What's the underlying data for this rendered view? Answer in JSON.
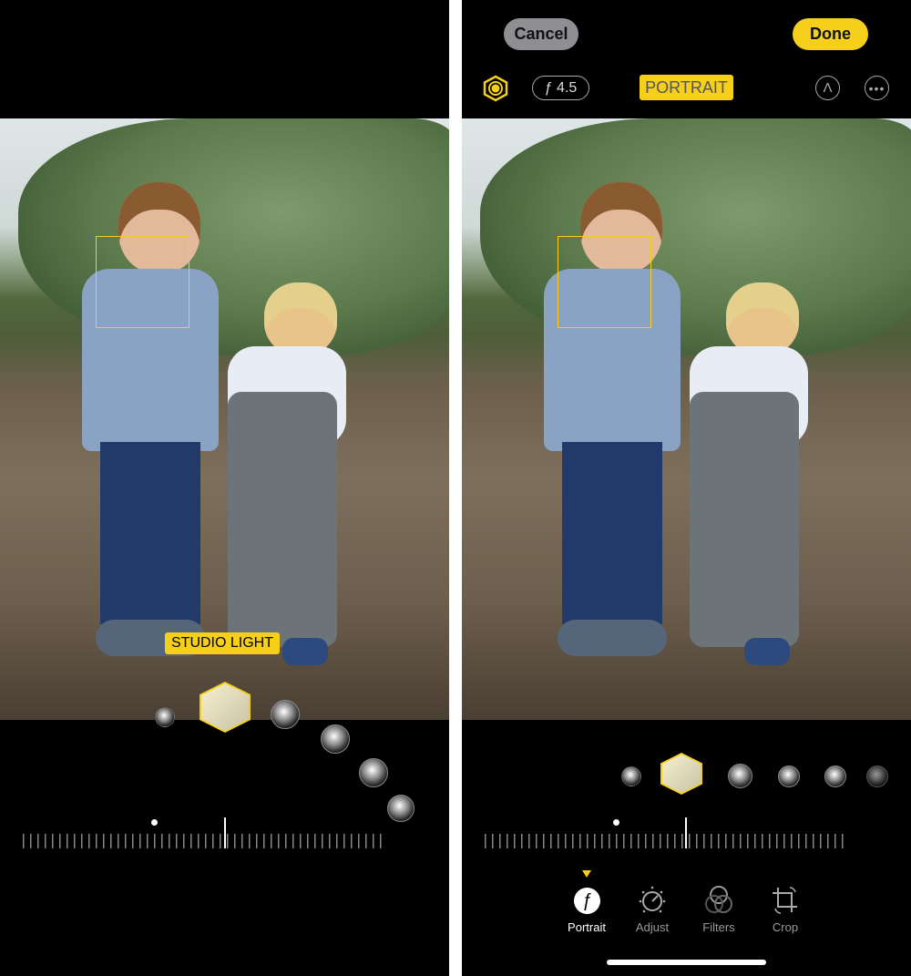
{
  "left": {
    "lighting_label": "STUDIO LIGHT"
  },
  "right": {
    "cancel_label": "Cancel",
    "done_label": "Done",
    "aperture_label": "ƒ 4.5",
    "mode_label": "PORTRAIT",
    "tools": [
      {
        "label": "Portrait",
        "icon": "f-aperture-icon"
      },
      {
        "label": "Adjust",
        "icon": "dial-icon"
      },
      {
        "label": "Filters",
        "icon": "filters-icon"
      },
      {
        "label": "Crop",
        "icon": "crop-rotate-icon"
      }
    ]
  },
  "colors": {
    "accent": "#f5cf1a",
    "cancel_bg": "#8e8e93"
  }
}
